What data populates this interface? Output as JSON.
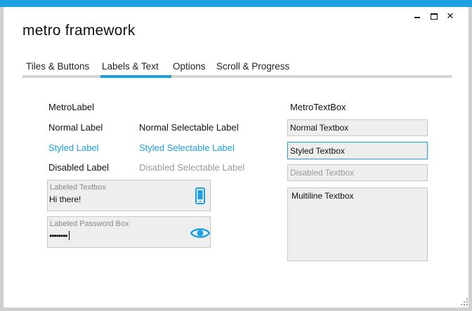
{
  "window": {
    "title": "metro framework",
    "controls": {
      "minimize": "minimize-icon",
      "maximize": "maximize-icon",
      "close": "close-icon",
      "close_glyph": "✕"
    }
  },
  "tabs": [
    {
      "label": "Tiles & Buttons",
      "selected": false
    },
    {
      "label": "Labels & Text",
      "selected": true
    },
    {
      "label": "Options",
      "selected": false
    },
    {
      "label": "Scroll & Progress",
      "selected": false
    }
  ],
  "labels_panel": {
    "heading": "MetroLabel",
    "normal_label": "Normal Label",
    "normal_selectable": "Normal Selectable Label",
    "styled_label": "Styled Label",
    "styled_selectable": "Styled Selectable Label",
    "disabled_label": "Disabled Label",
    "disabled_selectable": "Disabled Selectable Label"
  },
  "labeled_textbox": {
    "label": "Labeled Textbox",
    "value": "Hi there!",
    "icon": "phone-icon"
  },
  "labeled_password": {
    "label": "Labeled Password Box",
    "value": "••••••••",
    "icon": "eye-icon"
  },
  "textbox_panel": {
    "heading": "MetroTextBox",
    "normal": "Normal Textbox",
    "styled": "Styled Textbox",
    "disabled": "Disabled Textbox",
    "multiline": "Multiline Textbox"
  },
  "colors": {
    "accent": "#1ba1e2",
    "field_background": "#eeeeee",
    "disabled_text": "#9a9a9a"
  }
}
